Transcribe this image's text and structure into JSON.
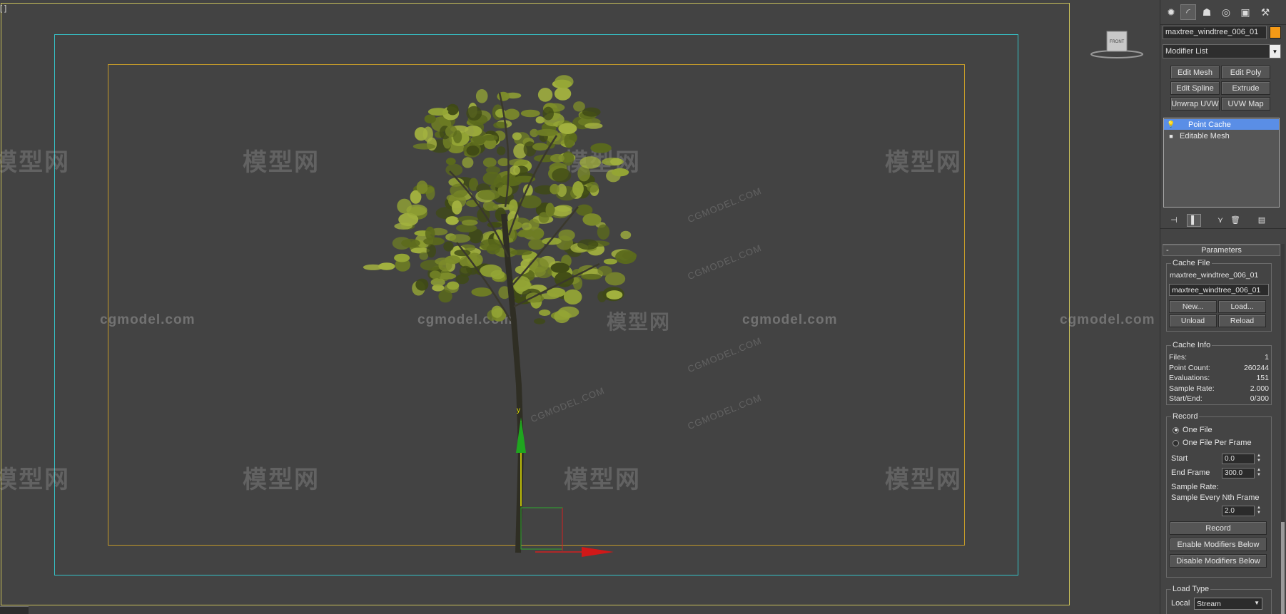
{
  "viewport": {
    "label": "[ ]",
    "viewcube_label": "FRONT",
    "gizmo_axis_label": "y",
    "watermark_logo": "模型网",
    "watermark_text": "cgmodel.com",
    "watermark_diag": "CGMODEL.COM"
  },
  "panel": {
    "tabs": [
      {
        "icon": "create-icon",
        "glyph": "✹"
      },
      {
        "icon": "modify-icon",
        "glyph": "◜"
      },
      {
        "icon": "hierarchy-icon",
        "glyph": "☗"
      },
      {
        "icon": "motion-icon",
        "glyph": "◎"
      },
      {
        "icon": "display-icon",
        "glyph": "▣"
      },
      {
        "icon": "utilities-icon",
        "glyph": "⚒"
      }
    ],
    "object_name": "maxtree_windtree_006_01",
    "object_color": "#f59a16",
    "modifier_list_label": "Modifier List",
    "modifier_buttons": {
      "edit_mesh": "Edit Mesh",
      "edit_poly": "Edit Poly",
      "edit_spline": "Edit Spline",
      "extrude": "Extrude",
      "unwrap_uvw": "Unwrap UVW",
      "uvw_map": "UVW Map"
    },
    "stack": [
      {
        "label": "Point Cache",
        "selected": true
      },
      {
        "label": "Editable Mesh",
        "selected": false
      }
    ],
    "accent_color": "#5a8ee6"
  },
  "parameters": {
    "title": "Parameters",
    "collapse_symbol": "-",
    "cache_file": {
      "title": "Cache File",
      "file_label": "maxtree_windtree_006_01",
      "file_field": "maxtree_windtree_006_01",
      "new_btn": "New...",
      "load_btn": "Load...",
      "unload_btn": "Unload",
      "reload_btn": "Reload"
    },
    "cache_info": {
      "title": "Cache Info",
      "rows": [
        {
          "label": "Files:",
          "value": "1"
        },
        {
          "label": "Point Count:",
          "value": "260244"
        },
        {
          "label": "Evaluations:",
          "value": "151"
        },
        {
          "label": "Sample Rate:",
          "value": "2.000"
        },
        {
          "label": "Start/End:",
          "value": "0/300"
        }
      ]
    },
    "record": {
      "title": "Record",
      "one_file": "One File",
      "one_file_per_frame": "One File Per Frame",
      "selected_mode": "One File",
      "start_label": "Start",
      "start_value": "0.0",
      "end_label": "End Frame",
      "end_value": "300.0",
      "sample_rate_label": "Sample Rate:",
      "sample_every_label": "Sample Every Nth Frame",
      "sample_value": "2.0",
      "record_btn": "Record",
      "enable_btn": "Enable Modifiers Below",
      "disable_btn": "Disable Modifiers Below"
    },
    "load_type": {
      "title": "Load Type",
      "local_label": "Local",
      "value": "Stream"
    }
  }
}
